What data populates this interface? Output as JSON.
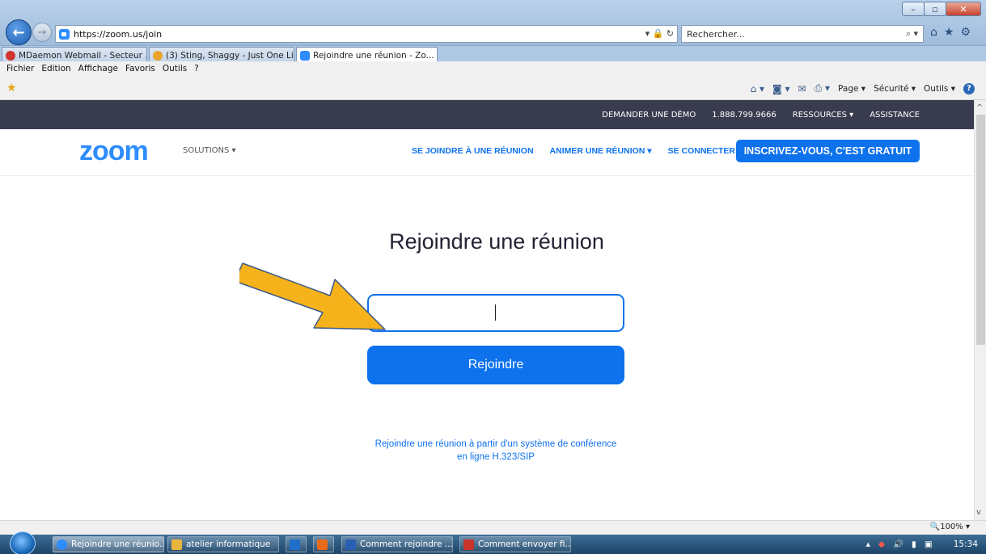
{
  "browser": {
    "url": "https://zoom.us/join",
    "search_placeholder": "Rechercher...",
    "tabs": [
      {
        "label": "MDaemon Webmail - Secteur ...",
        "color": "#d0342c"
      },
      {
        "label": "(3) Sting, Shaggy - Just One Lif...",
        "color": "#e8a32c"
      },
      {
        "label": "Rejoindre une réunion - Zo...",
        "color": "#2d8cff",
        "close": "✕"
      }
    ],
    "menus": [
      "Fichier",
      "Edition",
      "Affichage",
      "Favoris",
      "Outils",
      "?"
    ],
    "command_bar": {
      "page": "Page ▾",
      "security": "Sécurité ▾",
      "tools": "Outils ▾"
    },
    "zoom_level": "🔍100% ▾"
  },
  "zoom_page": {
    "topbar": {
      "demo": "DEMANDER UNE DÉMO",
      "phone": "1.888.799.9666",
      "resources": "RESSOURCES ▾",
      "support": "ASSISTANCE"
    },
    "logo": "zoom",
    "solutions": "SOLUTIONS ▾",
    "nav": {
      "join": "SE JOINDRE À UNE RÉUNION",
      "host": "ANIMER UNE RÉUNION ▾",
      "signin": "SE CONNECTER"
    },
    "signup": "INSCRIVEZ-VOUS, C'EST GRATUIT",
    "title": "Rejoindre une réunion",
    "input_value": "",
    "join_button": "Rejoindre",
    "sip_link_line1": "Rejoindre une réunion à partir d'un système de conférence",
    "sip_link_line2": "en ligne H.323/SIP"
  },
  "taskbar": {
    "items": [
      {
        "label": "Rejoindre une réunio...",
        "color": "#2d8cff"
      },
      {
        "label": "atelier informatique",
        "color": "#e8b43c"
      },
      {
        "label": "",
        "color": "#1f6fc9"
      },
      {
        "label": "",
        "color": "#e86a1a"
      },
      {
        "label": "Comment rejoindre ...",
        "color": "#2a5fb3"
      },
      {
        "label": "Comment envoyer fi...",
        "color": "#c9352b"
      }
    ],
    "clock": "15:34"
  },
  "colors": {
    "accent": "#0e72ed",
    "topbar": "#393c4e",
    "arrow": "#f5b21a"
  }
}
